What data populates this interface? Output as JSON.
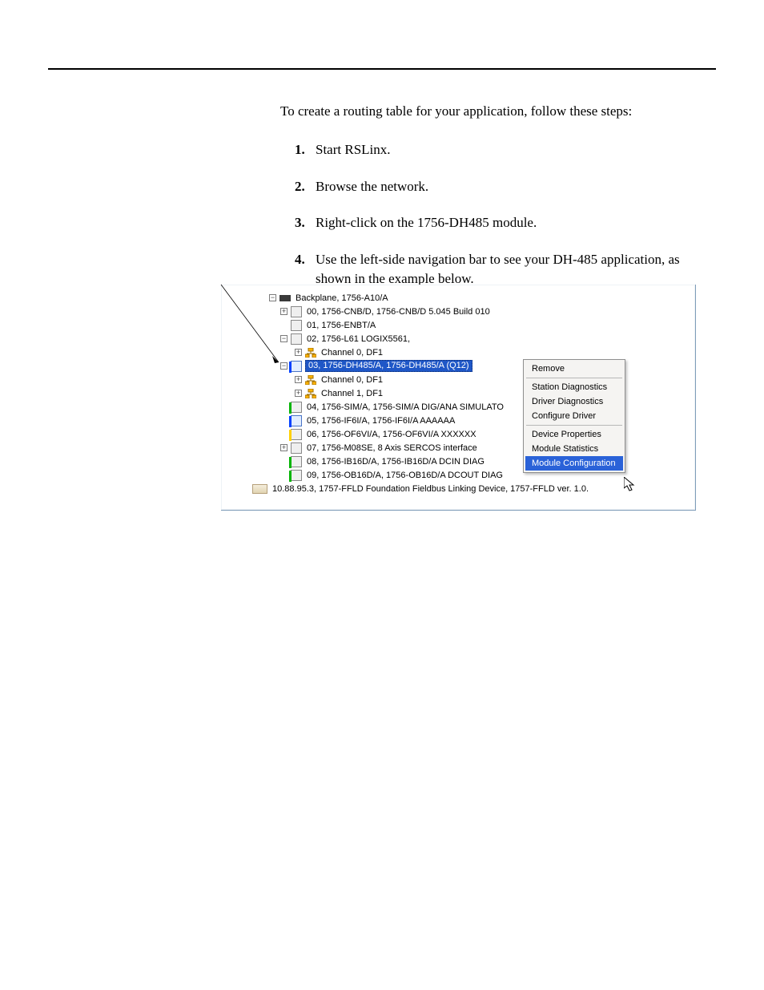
{
  "text": {
    "intro": "To create a routing table for your application, follow these steps:",
    "steps": [
      "Start RSLinx.",
      "Browse the network.",
      "Right-click on the 1756-DH485 module.",
      "Use the left-side navigation bar to see your DH-485 application, as shown in the example below."
    ]
  },
  "tree": {
    "root": "Backplane, 1756-A10/A",
    "nodes": [
      {
        "exp": "+",
        "icon": "slot",
        "label": "00, 1756-CNB/D, 1756-CNB/D 5.045 Build 010",
        "depth": 1
      },
      {
        "exp": "",
        "icon": "slot",
        "label": "01, 1756-ENBT/A",
        "depth": 1
      },
      {
        "exp": "-",
        "icon": "slot",
        "label": "02, 1756-L61 LOGIX5561,",
        "depth": 1
      },
      {
        "exp": "+",
        "icon": "net",
        "label": "Channel 0, DF1",
        "depth": 2
      },
      {
        "exp": "-",
        "icon": "slot-blue",
        "label": "03, 1756-DH485/A, 1756-DH485/A (Q12)",
        "selected": true,
        "depth": 1
      },
      {
        "exp": "+",
        "icon": "net",
        "label": "Channel 0, DF1",
        "depth": 2
      },
      {
        "exp": "+",
        "icon": "net",
        "label": "Channel 1, DF1",
        "depth": 2
      },
      {
        "exp": "",
        "icon": "slot-green",
        "label": "04, 1756-SIM/A, 1756-SIM/A DIG/ANA SIMULATO",
        "depth": 1
      },
      {
        "exp": "",
        "icon": "slot-blue2",
        "label": "05, 1756-IF6I/A, 1756-IF6I/A AAAAAA",
        "depth": 1
      },
      {
        "exp": "",
        "icon": "slot-yellow",
        "label": "06, 1756-OF6VI/A, 1756-OF6VI/A XXXXXX",
        "depth": 1
      },
      {
        "exp": "+",
        "icon": "slot",
        "label": "07, 1756-M08SE, 8 Axis SERCOS interface",
        "depth": 1
      },
      {
        "exp": "",
        "icon": "slot-green",
        "label": "08, 1756-IB16D/A, 1756-IB16D/A  DCIN  DIAG",
        "depth": 1
      },
      {
        "exp": "",
        "icon": "slot-green",
        "label": "09, 1756-OB16D/A, 1756-OB16D/A  DCOUT DIAG",
        "depth": 1
      }
    ],
    "footer": "10.88.95.3, 1757-FFLD Foundation Fieldbus Linking Device, 1757-FFLD ver. 1.0."
  },
  "context_menu": {
    "groups": [
      [
        "Remove"
      ],
      [
        "Station Diagnostics",
        "Driver Diagnostics",
        "Configure Driver"
      ],
      [
        "Device Properties",
        "Module Statistics",
        "Module Configuration"
      ]
    ],
    "selected": "Module Configuration"
  }
}
